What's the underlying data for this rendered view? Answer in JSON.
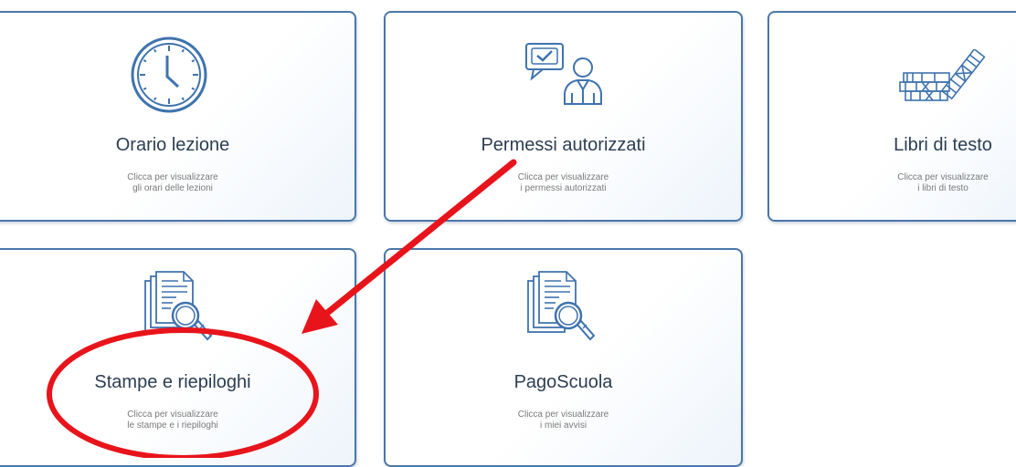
{
  "cards": [
    {
      "title": "Orario lezione",
      "desc_line1": "Clicca per visualizzare",
      "desc_line2": "gli orari delle lezioni",
      "icon": "clock-icon"
    },
    {
      "title": "Permessi autorizzati",
      "desc_line1": "Clicca per visualizzare",
      "desc_line2": "i permessi autorizzati",
      "icon": "approved-permission-person-icon"
    },
    {
      "title": "Libri di testo",
      "desc_line1": "Clicca per visualizzare",
      "desc_line2": "i libri di testo",
      "icon": "books-icon"
    },
    {
      "title": "Stampe e riepiloghi",
      "desc_line1": "Clicca per visualizzare",
      "desc_line2": "le stampe e i riepiloghi",
      "icon": "documents-magnifier-icon"
    },
    {
      "title": "PagoScuola",
      "desc_line1": "Clicca per visualizzare",
      "desc_line2": "i miei avvisi",
      "icon": "documents-magnifier-icon"
    }
  ],
  "colors": {
    "card_border": "#4a77a8",
    "icon_stroke": "#3f73ad",
    "title_text": "#2b3e52",
    "desc_text": "#7a7a7a",
    "annotation_red": "#e8141b"
  },
  "annotation": {
    "type": "red arrow from Permessi autorizzati card to red ellipse around Stampe e riepiloghi"
  }
}
